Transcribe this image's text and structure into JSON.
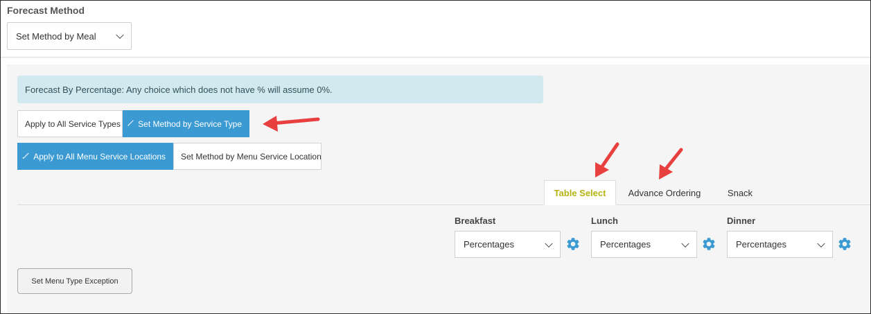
{
  "forecast": {
    "label": "Forecast Method",
    "select_value": "Set Method by Meal"
  },
  "alert": {
    "text": "Forecast By Percentage: Any choice which does not have % will assume 0%."
  },
  "service_type_group": {
    "apply_all": "Apply to All Service Types",
    "set_by_type": "Set Method by Service Type"
  },
  "location_group": {
    "apply_all": "Apply to All Menu Service Locations",
    "set_by_location": "Set Method by Menu Service Location"
  },
  "tabs": [
    {
      "label": "Table Select",
      "active": true
    },
    {
      "label": "Advance Ordering",
      "active": false
    },
    {
      "label": "Snack",
      "active": false
    }
  ],
  "meals": [
    {
      "label": "Breakfast",
      "value": "Percentages"
    },
    {
      "label": "Lunch",
      "value": "Percentages"
    },
    {
      "label": "Dinner",
      "value": "Percentages"
    }
  ],
  "exception_button": "Set Menu Type Exception",
  "colors": {
    "accent": "#3c9ad3",
    "active_tab_text": "#b5b312",
    "alert_bg": "#d2e9ef",
    "annotation_arrow": "#e8403f"
  }
}
